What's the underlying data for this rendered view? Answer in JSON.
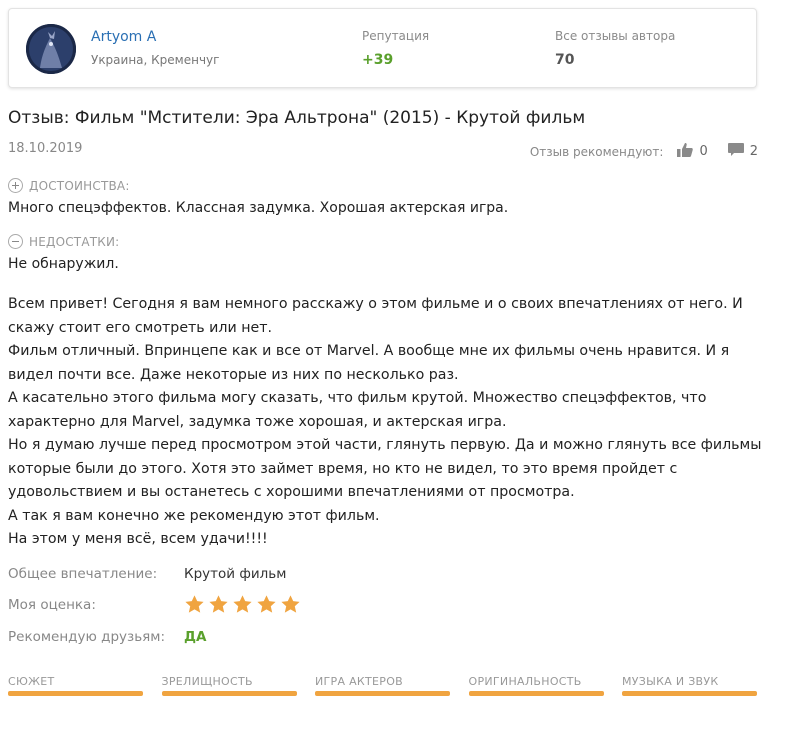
{
  "author": {
    "name": "Artyom A",
    "location": "Украина, Кременчуг",
    "reputation_label": "Репутация",
    "reputation_value": "+39",
    "reviews_label": "Все отзывы автора",
    "reviews_value": "70"
  },
  "review": {
    "title": "Отзыв: Фильм \"Мстители: Эра Альтрона\" (2015) - Крутой фильм",
    "date": "18.10.2019",
    "recommend_label": "Отзыв рекомендуют:",
    "likes": "0",
    "comments": "2",
    "pros_label": "ДОСТОИНСТВА:",
    "pros_text": "Много спецэффектов. Классная задумка. Хорошая актерская игра.",
    "cons_label": "НЕДОСТАТКИ:",
    "cons_text": "Не обнаружил.",
    "body": [
      "Всем привет! Сегодня я вам немного расскажу о этом фильме и о своих впечатлениях от него. И скажу стоит его смотреть или нет.",
      "Фильм отличный. Впринцепе как и все от Marvel. А вообще мне их фильмы очень нравится. И я видел почти все. Даже некоторые из них по несколько раз.",
      "А касательно этого фильма могу сказать, что фильм крутой. Множество спецэффектов, что характерно для Marvel, задумка тоже хорошая, и актерская игра.",
      "Но я думаю лучше перед просмотром этой части, глянуть первую. Да и можно глянуть все фильмы которые были до этого. Хотя это займет время, но кто не видел, то это время пройдет с удовольствием и вы останетесь с хорошими впечатлениями от просмотра.",
      "А так я вам конечно же рекомендую этот фильм.",
      "На этом у меня всё, всем удачи!!!!"
    ],
    "impression_label": "Общее впечатление:",
    "impression_value": "Крутой фильм",
    "rating_label": "Моя оценка:",
    "rating_value": 5,
    "rating_max": 5,
    "recommend_friends_label": "Рекомендую друзьям:",
    "recommend_friends_value": "ДА"
  },
  "categories": [
    {
      "label": "СЮЖЕТ",
      "level": 1.0
    },
    {
      "label": "ЗРЕЛИЩНОСТЬ",
      "level": 1.0
    },
    {
      "label": "ИГРА АКТЕРОВ",
      "level": 1.0
    },
    {
      "label": "ОРИГИНАЛЬНОСТЬ",
      "level": 1.0
    },
    {
      "label": "МУЗЫКА И ЗВУК",
      "level": 1.0
    }
  ],
  "colors": {
    "accent_green": "#5aa02c",
    "star": "#f0a440",
    "link": "#2a6fb3"
  }
}
